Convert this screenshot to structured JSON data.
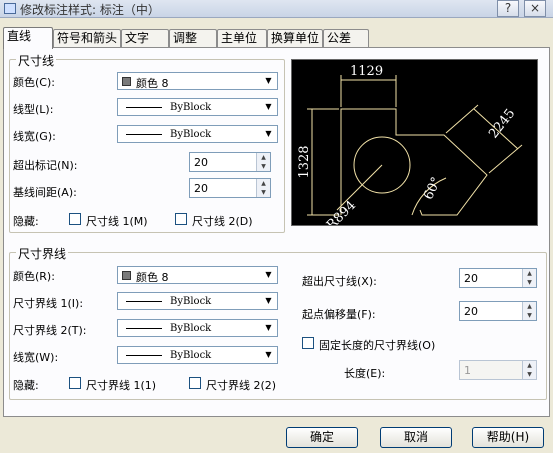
{
  "window": {
    "title": "修改标注样式: 标注（中）",
    "help_btn": "?",
    "close_btn": "×"
  },
  "tabs": [
    "直线",
    "符号和箭头",
    "文字",
    "调整",
    "主单位",
    "换算单位",
    "公差"
  ],
  "dim_line": {
    "title": "尺寸线",
    "color_label": "颜色(C):",
    "color_value": "颜色 8",
    "linetype_label": "线型(L):",
    "linetype_value": "ByBlock",
    "lineweight_label": "线宽(G):",
    "lineweight_value": "ByBlock",
    "extend_label": "超出标记(N):",
    "extend_value": "20",
    "baseline_label": "基线间距(A):",
    "baseline_value": "20",
    "suppress_label": "隐藏:",
    "suppress1": "尺寸线 1(M)",
    "suppress2": "尺寸线 2(D)"
  },
  "preview": {
    "dims": [
      "1129",
      "1328",
      "2245",
      "60°",
      "R894"
    ],
    "color": "#f2e2a8"
  },
  "ext_line": {
    "title": "尺寸界线",
    "color_label": "颜色(R):",
    "color_value": "颜色 8",
    "lt1_label": "尺寸界线 1(I):",
    "lt1_value": "ByBlock",
    "lt2_label": "尺寸界线 2(T):",
    "lt2_value": "ByBlock",
    "lw_label": "线宽(W):",
    "lw_value": "ByBlock",
    "suppress_label": "隐藏:",
    "suppress1": "尺寸界线 1(1)",
    "suppress2": "尺寸界线 2(2)",
    "beyond_label": "超出尺寸线(X):",
    "beyond_value": "20",
    "offset_label": "起点偏移量(F):",
    "offset_value": "20",
    "fixed_label": "固定长度的尺寸界线(O)",
    "length_label": "长度(E):",
    "length_value": "1"
  },
  "buttons": {
    "ok": "确定",
    "cancel": "取消",
    "help": "帮助(H)"
  },
  "colors": {
    "window_bg": "#ece9d8",
    "preview_bg": "#000000",
    "preview_stroke": "#f2e2a8"
  }
}
